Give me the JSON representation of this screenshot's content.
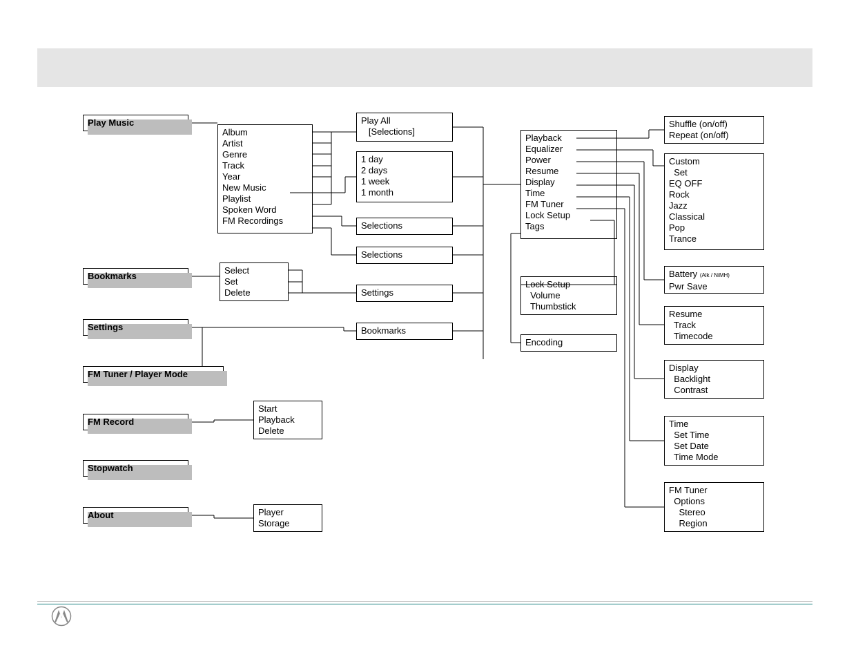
{
  "main_menu": {
    "play_music": "Play Music",
    "bookmarks": "Bookmarks",
    "settings": "Settings",
    "fm_tuner": "FM Tuner / Player Mode",
    "fm_record": "FM Record",
    "stopwatch": "Stopwatch",
    "about": "About"
  },
  "play_music_sub": [
    "Album",
    "Artist",
    "Genre",
    "Track",
    "Year",
    "New Music",
    "Playlist",
    "Spoken Word",
    "FM Recordings"
  ],
  "play_all": [
    "Play All",
    "   [Selections]"
  ],
  "new_music_times": [
    "1 day",
    "2 days",
    "1 week",
    "1 month"
  ],
  "selections1": "Selections",
  "selections2": "Selections",
  "bookmarks_sub": [
    "Select",
    "Set",
    "Delete"
  ],
  "settings_box": "Settings",
  "bookmarks_box": "Bookmarks",
  "fm_record_sub": [
    "Start",
    "Playback",
    "Delete"
  ],
  "about_sub": [
    "Player",
    "Storage"
  ],
  "settings_main": [
    "Playback",
    "Equalizer",
    "Power",
    "Resume",
    "Display",
    "Time",
    "FM Tuner",
    "Lock Setup",
    "Tags"
  ],
  "lock_setup": [
    "Lock Setup",
    "  Volume",
    "  Thumbstick"
  ],
  "encoding": "Encoding",
  "playback_opts": [
    "Shuffle (on/off)",
    "Repeat (on/off)"
  ],
  "eq_opts": [
    "Custom",
    "  Set",
    "EQ OFF",
    "Rock",
    "Jazz",
    "Classical",
    "Pop",
    "Trance"
  ],
  "power_opts_label": "Battery",
  "power_opts_small": "(Alk / NiMH)",
  "power_opts2": "Pwr Save",
  "resume_opts": [
    "Resume",
    "  Track",
    "  Timecode"
  ],
  "display_opts": [
    "Display",
    "  Backlight",
    "  Contrast"
  ],
  "time_opts": [
    "Time",
    "  Set Time",
    "  Set Date",
    "  Time Mode"
  ],
  "fm_tuner_opts": [
    "FM Tuner",
    "  Options",
    "    Stereo",
    "    Region"
  ]
}
